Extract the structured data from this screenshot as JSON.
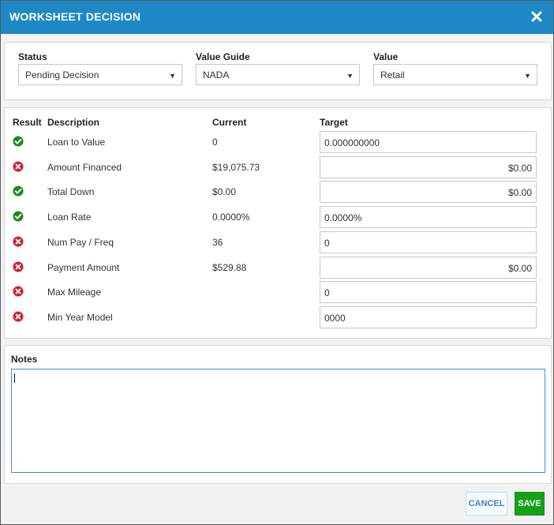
{
  "dialog": {
    "title": "WORKSHEET DECISION",
    "close_icon": "close-icon"
  },
  "filters": {
    "status": {
      "label": "Status",
      "value": "Pending Decision"
    },
    "value_guide": {
      "label": "Value Guide",
      "value": "NADA"
    },
    "value": {
      "label": "Value",
      "value": "Retail"
    },
    "caret_glyph": "▼"
  },
  "criteria": {
    "headers": {
      "result": "Result",
      "description": "Description",
      "current": "Current",
      "target": "Target"
    },
    "rows": [
      {
        "result": "pass",
        "description": "Loan to Value",
        "current": "0",
        "target": "0.000000000",
        "align": "left"
      },
      {
        "result": "fail",
        "description": "Amount Financed",
        "current": "$19,075.73",
        "target": "$0.00",
        "align": "right"
      },
      {
        "result": "pass",
        "description": "Total Down",
        "current": "$0.00",
        "target": "$0.00",
        "align": "right"
      },
      {
        "result": "pass",
        "description": "Loan Rate",
        "current": "0.0000%",
        "target": "0.0000%",
        "align": "left"
      },
      {
        "result": "fail",
        "description": "Num Pay / Freq",
        "current": "36",
        "target": "0",
        "align": "left"
      },
      {
        "result": "fail",
        "description": "Payment Amount",
        "current": "$529.88",
        "target": "$0.00",
        "align": "right"
      },
      {
        "result": "fail",
        "description": "Max Mileage",
        "current": "",
        "target": "0",
        "align": "left"
      },
      {
        "result": "fail",
        "description": "Min Year Model",
        "current": "",
        "target": "0000",
        "align": "left"
      }
    ]
  },
  "notes": {
    "label": "Notes",
    "value": ""
  },
  "buttons": {
    "cancel": "CANCEL",
    "save": "SAVE"
  },
  "colors": {
    "header_bg": "#1e88c7",
    "pass": "#1a8a1a",
    "fail": "#d81c28",
    "save_bg": "#15a115",
    "cancel_text": "#3d86c2"
  }
}
